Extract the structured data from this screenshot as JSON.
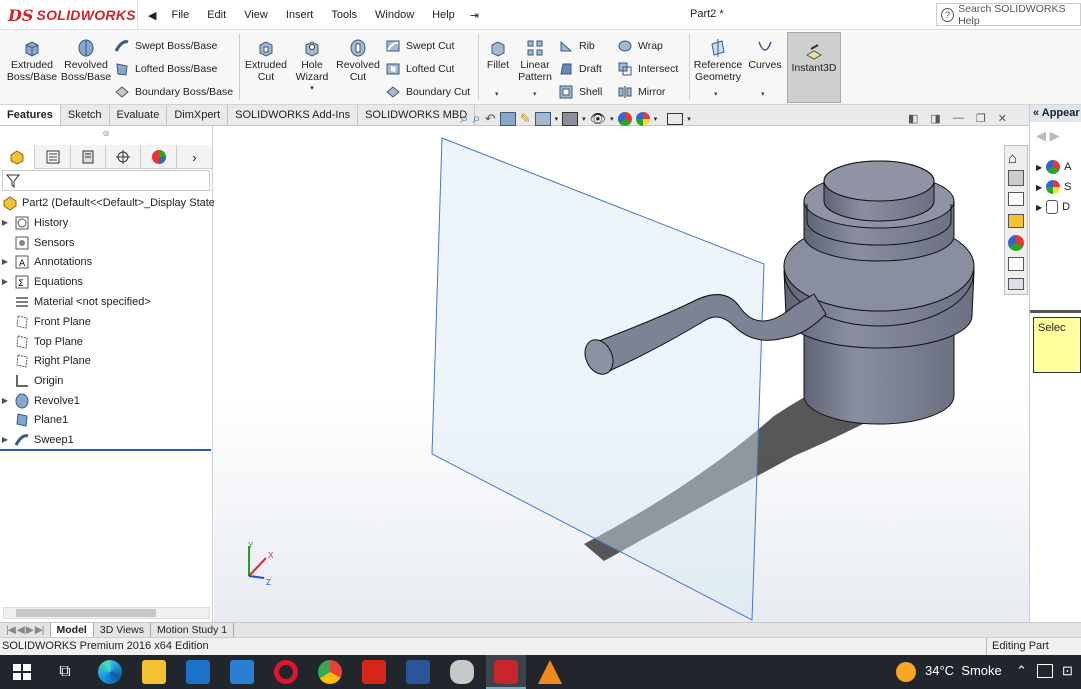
{
  "app": {
    "logo_ds": "DS",
    "logo_name": "SOLIDWORKS",
    "document_title": "Part2 *"
  },
  "menu": [
    "File",
    "Edit",
    "View",
    "Insert",
    "Tools",
    "Window",
    "Help"
  ],
  "search_placeholder": "Search SOLIDWORKS Help",
  "commands": {
    "extruded_boss": "Extruded Boss/Base",
    "revolved_boss": "Revolved Boss/Base",
    "swept_boss": "Swept Boss/Base",
    "lofted_boss": "Lofted Boss/Base",
    "boundary_boss": "Boundary Boss/Base",
    "extruded_cut": "Extruded Cut",
    "hole_wizard": "Hole Wizard",
    "revolved_cut": "Revolved Cut",
    "swept_cut": "Swept Cut",
    "lofted_cut": "Lofted Cut",
    "boundary_cut": "Boundary Cut",
    "fillet": "Fillet",
    "linear_pattern": "Linear Pattern",
    "rib": "Rib",
    "draft": "Draft",
    "shell": "Shell",
    "wrap": "Wrap",
    "intersect": "Intersect",
    "mirror": "Mirror",
    "reference_geometry": "Reference Geometry",
    "curves": "Curves",
    "instant3d": "Instant3D"
  },
  "tabs": [
    "Features",
    "Sketch",
    "Evaluate",
    "DimXpert",
    "SOLIDWORKS Add-Ins",
    "SOLIDWORKS MBD"
  ],
  "tree": {
    "root": "Part2  (Default<<Default>_Display State",
    "items": [
      "History",
      "Sensors",
      "Annotations",
      "Equations",
      "Material <not specified>",
      "Front Plane",
      "Top Plane",
      "Right Plane",
      "Origin",
      "Revolve1",
      "Plane1",
      "Sweep1"
    ]
  },
  "task_pane": {
    "header": "Appear",
    "item_a": "A",
    "item_s": "S",
    "item_d": "D",
    "tooltip": "Selec"
  },
  "triad": {
    "x": "X",
    "y": "Y",
    "z": "Z"
  },
  "bottom_tabs": [
    "Model",
    "3D Views",
    "Motion Study 1"
  ],
  "status": {
    "left": "SOLIDWORKS Premium 2016 x64 Edition",
    "right": "Editing Part"
  },
  "taskbar": {
    "weather": "34°C  Smoke"
  },
  "colors": {
    "brand": "#d2232a",
    "model": "#7d8294",
    "plane": "#d8e8f5"
  }
}
